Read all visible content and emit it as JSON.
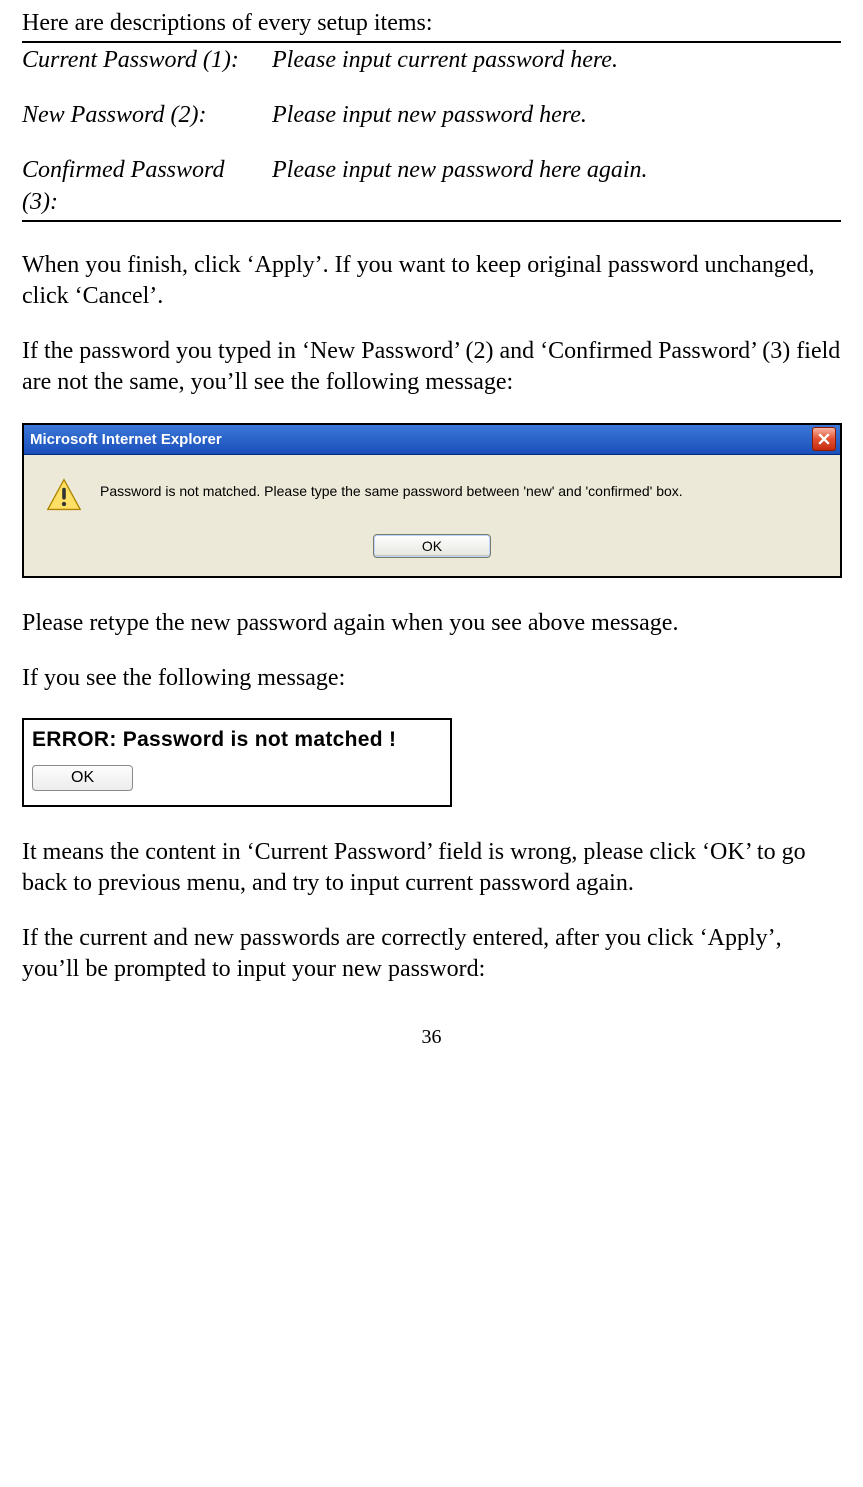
{
  "intro": "Here are descriptions of every setup items:",
  "table": {
    "rows": [
      {
        "label": "Current Password (1):",
        "desc": "Please input current password here."
      },
      {
        "label": "New Password (2):",
        "desc": "Please input new password here."
      },
      {
        "label": "Confirmed Password (3):",
        "desc": "Please input new password here again."
      }
    ]
  },
  "para1": "When you finish, click ‘Apply’. If you want to keep original password unchanged, click ‘Cancel’.",
  "para2": "If the password you typed in ‘New Password’ (2) and ‘Confirmed Password’ (3) field are not the same, you’ll see the following message:",
  "dialog1": {
    "title": "Microsoft Internet Explorer",
    "message": "Password is not matched. Please type the same password between 'new' and 'confirmed' box.",
    "ok": "OK"
  },
  "para3": "Please retype the new password again when you see above message.",
  "para4": "If you see the following message:",
  "dialog2": {
    "message": "ERROR: Password is not matched !",
    "ok": "OK"
  },
  "para5": "It means the content in ‘Current Password’ field is wrong, please click ‘OK’ to go back to previous menu, and try to input current password again.",
  "para6": "If the current and new passwords are correctly entered, after you click ‘Apply’, you’ll be prompted to input your new password:",
  "page_number": "36"
}
